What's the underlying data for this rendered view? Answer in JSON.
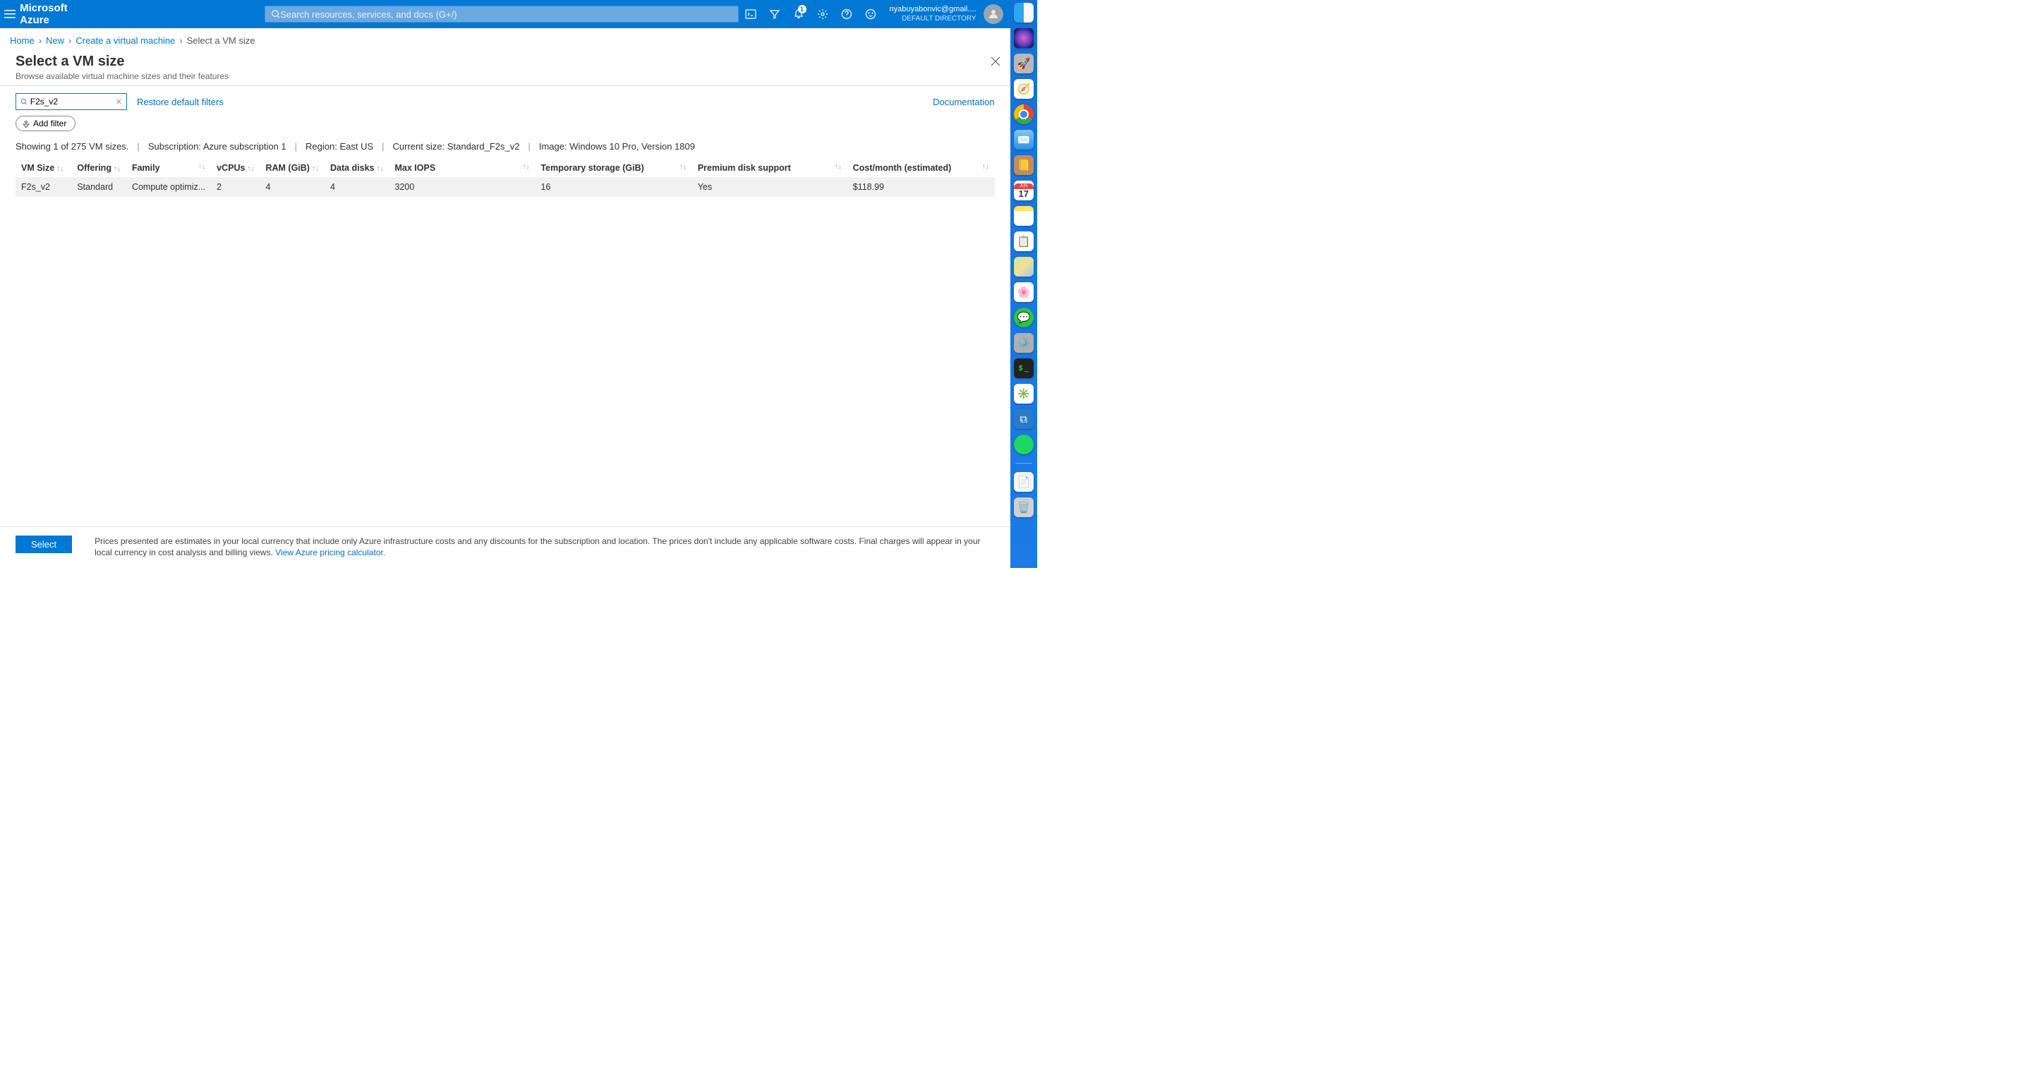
{
  "header": {
    "brand": "Microsoft Azure",
    "search_placeholder": "Search resources, services, and docs (G+/)",
    "notification_count": "1",
    "account_email": "nyabuyabonvic@gmail....",
    "account_directory": "DEFAULT DIRECTORY"
  },
  "breadcrumb": {
    "items": [
      {
        "label": "Home",
        "link": true
      },
      {
        "label": "New",
        "link": true
      },
      {
        "label": "Create a virtual machine",
        "link": true
      },
      {
        "label": "Select a VM size",
        "link": false
      }
    ]
  },
  "page": {
    "title": "Select a VM size",
    "subtitle": "Browse available virtual machine sizes and their features"
  },
  "filters": {
    "search_value": "F2s_v2",
    "restore_label": "Restore default filters",
    "documentation_label": "Documentation",
    "add_filter_label": "Add filter"
  },
  "meta": {
    "count": "Showing 1 of 275 VM sizes.",
    "subscription": "Subscription: Azure subscription 1",
    "region": "Region: East US",
    "current_size": "Current size: Standard_F2s_v2",
    "image": "Image: Windows 10 Pro, Version 1809"
  },
  "table": {
    "columns": [
      "VM Size",
      "Offering",
      "Family",
      "vCPUs",
      "RAM (GiB)",
      "Data disks",
      "Max IOPS",
      "Temporary storage (GiB)",
      "Premium disk support",
      "Cost/month (estimated)"
    ],
    "rows": [
      {
        "vm_size": "F2s_v2",
        "offering": "Standard",
        "family": "Compute optimiz...",
        "vcpus": "2",
        "ram": "4",
        "data_disks": "4",
        "max_iops": "3200",
        "temp_storage": "16",
        "premium": "Yes",
        "cost": "$118.99"
      }
    ]
  },
  "footer": {
    "select_label": "Select",
    "text_before": "Prices presented are estimates in your local currency that include only Azure infrastructure costs and any discounts for the subscription and location. The prices don't include any applicable software costs. Final charges will appear in your local currency in cost analysis and billing views. ",
    "link_label": "View Azure pricing calculator."
  },
  "dock": {
    "calendar_month": "JUN",
    "calendar_day": "17",
    "terminal_prompt": "$ _"
  }
}
